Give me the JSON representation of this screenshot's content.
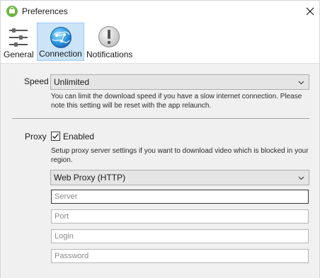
{
  "window": {
    "title": "Preferences"
  },
  "toolbar": {
    "tabs": [
      {
        "label": "General",
        "icon": "sliders-icon"
      },
      {
        "label": "Connection",
        "icon": "globe-icon",
        "selected": true
      },
      {
        "label": "Notifications",
        "icon": "exclamation-icon"
      }
    ]
  },
  "speed": {
    "label": "Speed",
    "value": "Unlimited",
    "hint": "You can limit the download speed if you have a slow internet connection. Please note this setting will be reset with the app relaunch."
  },
  "proxy": {
    "label": "Proxy",
    "enabled_label": "Enabled",
    "enabled": true,
    "hint": "Setup proxy server settings if you want to download video which is blocked in your region.",
    "type": "Web Proxy (HTTP)",
    "server_placeholder": "Server",
    "port_placeholder": "Port",
    "login_placeholder": "Login",
    "password_placeholder": "Password"
  },
  "colors": {
    "selected_tab_bg": "#cce4f7",
    "selected_tab_border": "#99c9ef",
    "content_bg": "#f0f0f0",
    "app_icon": "#6fb544"
  }
}
